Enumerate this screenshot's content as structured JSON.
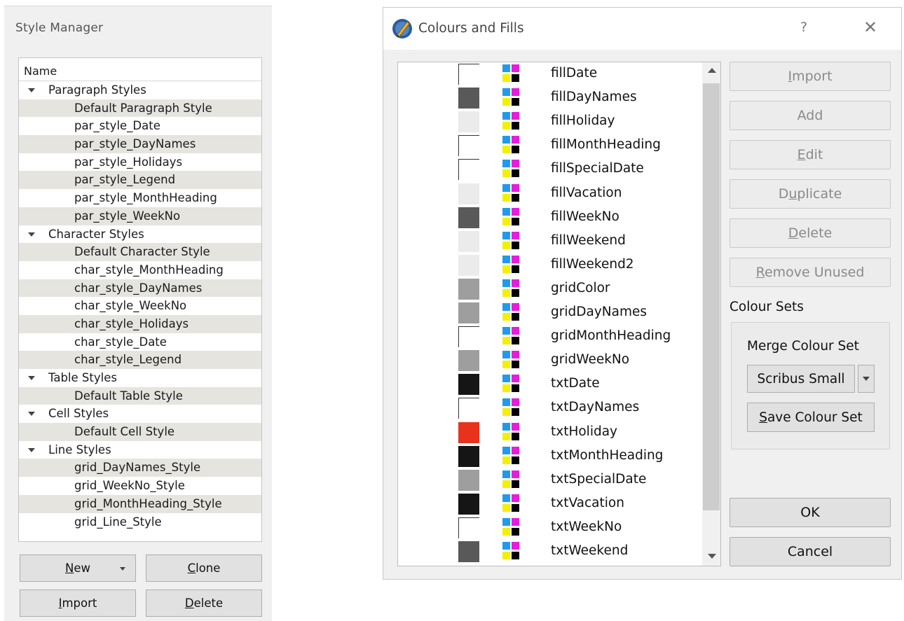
{
  "style_manager": {
    "title": "Style Manager",
    "tree_header": "Name",
    "rows": [
      {
        "label": "Paragraph Styles",
        "type": "group"
      },
      {
        "label": "Default Paragraph Style",
        "type": "leaf"
      },
      {
        "label": "par_style_Date",
        "type": "leaf"
      },
      {
        "label": "par_style_DayNames",
        "type": "leaf"
      },
      {
        "label": "par_style_Holidays",
        "type": "leaf"
      },
      {
        "label": "par_style_Legend",
        "type": "leaf"
      },
      {
        "label": "par_style_MonthHeading",
        "type": "leaf"
      },
      {
        "label": "par_style_WeekNo",
        "type": "leaf"
      },
      {
        "label": "Character Styles",
        "type": "group"
      },
      {
        "label": "Default Character Style",
        "type": "leaf"
      },
      {
        "label": "char_style_MonthHeading",
        "type": "leaf"
      },
      {
        "label": "char_style_DayNames",
        "type": "leaf"
      },
      {
        "label": "char_style_WeekNo",
        "type": "leaf"
      },
      {
        "label": "char_style_Holidays",
        "type": "leaf"
      },
      {
        "label": "char_style_Date",
        "type": "leaf"
      },
      {
        "label": "char_style_Legend",
        "type": "leaf"
      },
      {
        "label": "Table Styles",
        "type": "group"
      },
      {
        "label": "Default Table Style",
        "type": "leaf"
      },
      {
        "label": "Cell Styles",
        "type": "group"
      },
      {
        "label": "Default Cell Style",
        "type": "leaf"
      },
      {
        "label": "Line Styles",
        "type": "group"
      },
      {
        "label": "grid_DayNames_Style",
        "type": "leaf"
      },
      {
        "label": "grid_WeekNo_Style",
        "type": "leaf"
      },
      {
        "label": "grid_MonthHeading_Style",
        "type": "leaf"
      },
      {
        "label": "grid_Line_Style",
        "type": "leaf"
      }
    ],
    "buttons": {
      "new": {
        "key": "N",
        "rest": "ew"
      },
      "clone": {
        "key": "C",
        "rest": "lone"
      },
      "import": {
        "key": "I",
        "rest": "mport"
      },
      "delete": {
        "key": "D",
        "rest": "elete"
      }
    }
  },
  "colours_dialog": {
    "title": "Colours and Fills",
    "help": "?",
    "close": "✕",
    "colours": [
      {
        "name": "fillDate",
        "swatch": "#ffffff"
      },
      {
        "name": "fillDayNames",
        "swatch": "#595959"
      },
      {
        "name": "fillHoliday",
        "swatch": "#ebebeb"
      },
      {
        "name": "fillMonthHeading",
        "swatch": "#ffffff"
      },
      {
        "name": "fillSpecialDate",
        "swatch": "#ffffff"
      },
      {
        "name": "fillVacation",
        "swatch": "#ebebeb"
      },
      {
        "name": "fillWeekNo",
        "swatch": "#595959"
      },
      {
        "name": "fillWeekend",
        "swatch": "#ebebeb"
      },
      {
        "name": "fillWeekend2",
        "swatch": "#ebebeb"
      },
      {
        "name": "gridColor",
        "swatch": "#9e9e9e"
      },
      {
        "name": "gridDayNames",
        "swatch": "#9e9e9e"
      },
      {
        "name": "gridMonthHeading",
        "swatch": "#ffffff"
      },
      {
        "name": "gridWeekNo",
        "swatch": "#9e9e9e"
      },
      {
        "name": "txtDate",
        "swatch": "#151515"
      },
      {
        "name": "txtDayNames",
        "swatch": "#ffffff"
      },
      {
        "name": "txtHoliday",
        "swatch": "#e8321e"
      },
      {
        "name": "txtMonthHeading",
        "swatch": "#151515"
      },
      {
        "name": "txtSpecialDate",
        "swatch": "#9e9e9e"
      },
      {
        "name": "txtVacation",
        "swatch": "#151515"
      },
      {
        "name": "txtWeekNo",
        "swatch": "#ffffff"
      },
      {
        "name": "txtWeekend",
        "swatch": "#595959"
      }
    ],
    "cmyk_colors": {
      "c": "#1e9bf0",
      "m": "#e61edc",
      "y": "#f5f000",
      "k": "#000000"
    },
    "buttons": {
      "import": {
        "key": "I",
        "rest": "mport"
      },
      "add": "Add",
      "edit": {
        "key": "E",
        "rest": "dit"
      },
      "duplicate": {
        "pre": "D",
        "key": "u",
        "rest": "plicate"
      },
      "delete": {
        "key": "D",
        "rest": "elete"
      },
      "remove_unused": {
        "key": "R",
        "rest": "emove Unused"
      },
      "ok": "OK",
      "cancel": "Cancel"
    },
    "colour_sets": {
      "label": "Colour Sets",
      "merge_label": "Merge Colour Set",
      "selected": "Scribus Small",
      "save": {
        "key": "S",
        "rest": "ave Colour Set"
      }
    }
  }
}
